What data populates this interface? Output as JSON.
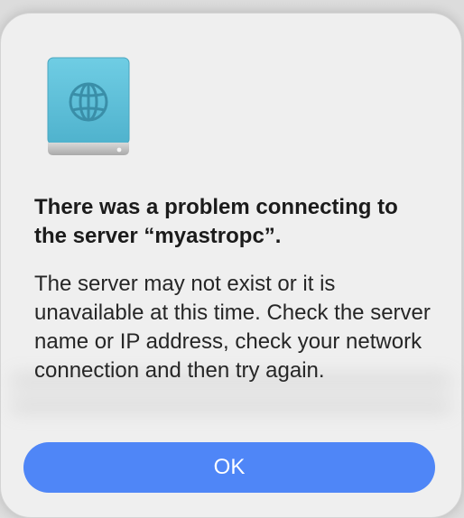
{
  "dialog": {
    "icon": "network-server-icon",
    "title": "There was a problem connecting to the server “myastropc”.",
    "message": "The server may not exist or it is unavailable at this time. Check the server name or IP address, check your network connection and then try again.",
    "ok_label": "OK"
  },
  "colors": {
    "accent": "#4f86f7",
    "icon_body": "#5bbfd8",
    "icon_base": "#c7c7c7"
  }
}
